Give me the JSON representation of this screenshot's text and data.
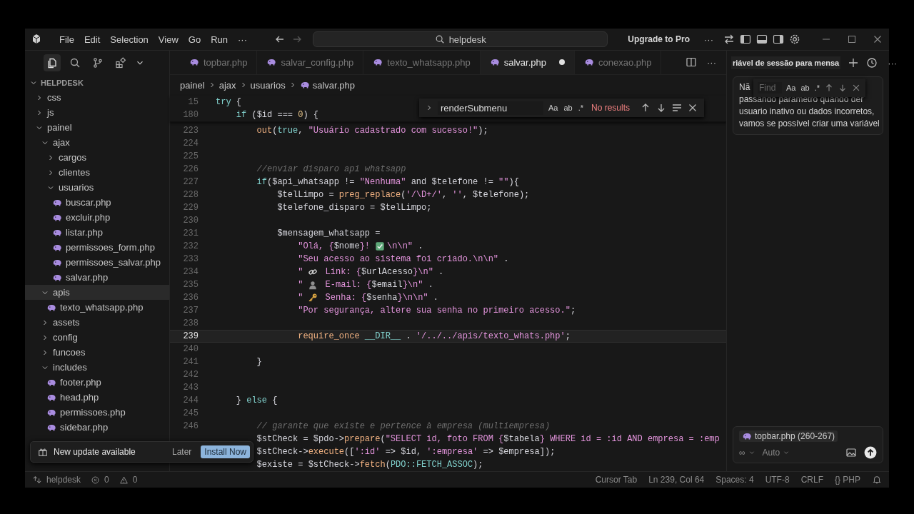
{
  "menu_bar": {
    "items": [
      "File",
      "Edit",
      "Selection",
      "View",
      "Go",
      "Run"
    ],
    "overflow": "···"
  },
  "command_center": {
    "value": "helpdesk"
  },
  "upgrade_button": "Upgrade to Pro",
  "title_overflow": "···",
  "activity_bar": [
    {
      "kind": "explorer",
      "selected": true
    },
    {
      "kind": "search",
      "selected": false
    },
    {
      "kind": "source_control",
      "selected": false
    },
    {
      "kind": "extensions",
      "selected": false
    }
  ],
  "explorer": {
    "title": "HELPDESK",
    "tree": [
      {
        "label": "css",
        "kind": "folder",
        "expanded": false,
        "selected": false
      },
      {
        "label": "js",
        "kind": "folder",
        "expanded": false,
        "selected": false
      },
      {
        "label": "painel",
        "kind": "folder",
        "expanded": true,
        "selected": false,
        "children": [
          {
            "label": "ajax",
            "kind": "folder",
            "expanded": true,
            "selected": false,
            "children": [
              {
                "label": "cargos",
                "kind": "folder",
                "expanded": false,
                "selected": false
              },
              {
                "label": "clientes",
                "kind": "folder",
                "expanded": false,
                "selected": false
              },
              {
                "label": "usuarios",
                "kind": "folder",
                "expanded": true,
                "selected": false,
                "children": [
                  {
                    "label": "buscar.php",
                    "kind": "file",
                    "selected": false
                  },
                  {
                    "label": "excluir.php",
                    "kind": "file",
                    "selected": false
                  },
                  {
                    "label": "listar.php",
                    "kind": "file",
                    "selected": false
                  },
                  {
                    "label": "permissoes_form.php",
                    "kind": "file",
                    "selected": false
                  },
                  {
                    "label": "permissoes_salvar.php",
                    "kind": "file",
                    "selected": false
                  },
                  {
                    "label": "salvar.php",
                    "kind": "file",
                    "selected": false
                  }
                ]
              }
            ]
          },
          {
            "label": "apis",
            "kind": "folder",
            "expanded": true,
            "selected": true,
            "children": [
              {
                "label": "texto_whatsapp.php",
                "kind": "file",
                "selected": false
              }
            ]
          },
          {
            "label": "assets",
            "kind": "folder",
            "expanded": false,
            "selected": false
          },
          {
            "label": "config",
            "kind": "folder",
            "expanded": false,
            "selected": false
          },
          {
            "label": "funcoes",
            "kind": "folder",
            "expanded": false,
            "selected": false
          },
          {
            "label": "includes",
            "kind": "folder",
            "expanded": true,
            "selected": false,
            "children": [
              {
                "label": "footer.php",
                "kind": "file",
                "selected": false
              },
              {
                "label": "head.php",
                "kind": "file",
                "selected": false
              },
              {
                "label": "permissoes.php",
                "kind": "file",
                "selected": false
              },
              {
                "label": "sidebar.php",
                "kind": "file",
                "selected": false
              }
            ]
          }
        ]
      }
    ]
  },
  "tabs": [
    {
      "label": "topbar.php",
      "selected": false,
      "modified": false
    },
    {
      "label": "salvar_config.php",
      "selected": false,
      "modified": false
    },
    {
      "label": "texto_whatsapp.php",
      "selected": false,
      "modified": false
    },
    {
      "label": "salvar.php",
      "selected": true,
      "modified": true
    },
    {
      "label": "conexao.php",
      "selected": false,
      "modified": false
    }
  ],
  "tab_overflow": "···",
  "breadcrumb": [
    "painel",
    "ajax",
    "usuarios",
    "salvar.php"
  ],
  "find_widget": {
    "value": "renderSubmenu",
    "options": [
      "Aa",
      "ab",
      ".*"
    ],
    "result": "No results"
  },
  "code": {
    "sticky": [
      {
        "num": "15",
        "current": false,
        "tokens": [
          {
            "text": "try",
            "kind": "kw"
          },
          {
            "text": " {",
            "kind": "p"
          }
        ]
      },
      {
        "num": "180",
        "current": false,
        "tokens": [
          {
            "text": "    if",
            "kind": "kw"
          },
          {
            "text": " (",
            "kind": "p"
          },
          {
            "text": "$id",
            "kind": "v"
          },
          {
            "text": " === ",
            "kind": "p"
          },
          {
            "text": "0",
            "kind": "n"
          },
          {
            "text": ") {",
            "kind": "p"
          }
        ]
      }
    ],
    "lines": [
      {
        "num": "223",
        "current": false,
        "tokens": [
          {
            "text": "        out",
            "kind": "fn"
          },
          {
            "text": "(",
            "kind": "p"
          },
          {
            "text": "true",
            "kind": "c"
          },
          {
            "text": ", ",
            "kind": "p"
          },
          {
            "text": "\"Usuário cadastrado com sucesso!\"",
            "kind": "s"
          },
          {
            "text": ");",
            "kind": "p"
          }
        ]
      },
      {
        "num": "224",
        "current": false
      },
      {
        "num": "225",
        "current": false
      },
      {
        "num": "226",
        "current": false,
        "tokens": [
          {
            "text": "        //enviar disparo api whatsapp",
            "kind": "cm"
          }
        ]
      },
      {
        "num": "227",
        "current": false,
        "tokens": [
          {
            "text": "        if",
            "kind": "kw"
          },
          {
            "text": "(",
            "kind": "p"
          },
          {
            "text": "$api_whatsapp",
            "kind": "v"
          },
          {
            "text": " != ",
            "kind": "p"
          },
          {
            "text": "\"Nenhuma\"",
            "kind": "s"
          },
          {
            "text": " and ",
            "kind": "p"
          },
          {
            "text": "$telefone",
            "kind": "v"
          },
          {
            "text": " != ",
            "kind": "p"
          },
          {
            "text": "\"\"",
            "kind": "s"
          },
          {
            "text": "){",
            "kind": "p"
          }
        ]
      },
      {
        "num": "228",
        "current": false,
        "tokens": [
          {
            "text": "            $telLimpo",
            "kind": "v"
          },
          {
            "text": " = ",
            "kind": "p"
          },
          {
            "text": "preg_replace",
            "kind": "fn"
          },
          {
            "text": "(",
            "kind": "p"
          },
          {
            "text": "'/\\D+/'",
            "kind": "s"
          },
          {
            "text": ", ",
            "kind": "p"
          },
          {
            "text": "''",
            "kind": "s"
          },
          {
            "text": ", ",
            "kind": "p"
          },
          {
            "text": "$telefone",
            "kind": "v"
          },
          {
            "text": ");",
            "kind": "p"
          }
        ]
      },
      {
        "num": "229",
        "current": false,
        "tokens": [
          {
            "text": "            $telefone_disparo",
            "kind": "v"
          },
          {
            "text": " = ",
            "kind": "p"
          },
          {
            "text": "$telLimpo",
            "kind": "v"
          },
          {
            "text": ";",
            "kind": "p"
          }
        ]
      },
      {
        "num": "230",
        "current": false
      },
      {
        "num": "231",
        "current": false,
        "tokens": [
          {
            "text": "            $mensagem_whatsapp",
            "kind": "v"
          },
          {
            "text": " =",
            "kind": "p"
          }
        ]
      },
      {
        "num": "232",
        "current": false,
        "tokens": [
          {
            "text": "                \"Olá, {",
            "kind": "s"
          },
          {
            "text": "$nome",
            "kind": "v"
          },
          {
            "text": "}!",
            "kind": "s"
          },
          {
            "kind": "emoji_check"
          },
          {
            "text": "\\n\\n\"",
            "kind": "s"
          },
          {
            "text": " .",
            "kind": "p"
          }
        ]
      },
      {
        "num": "233",
        "current": false,
        "tokens": [
          {
            "text": "                \"Seu acesso ao sistema foi criado.\\n\\n\"",
            "kind": "s"
          },
          {
            "text": " .",
            "kind": "p"
          }
        ]
      },
      {
        "num": "234",
        "current": false,
        "tokens": [
          {
            "text": "                \"",
            "kind": "s"
          },
          {
            "kind": "emoji_link"
          },
          {
            "text": " Link: {",
            "kind": "s"
          },
          {
            "text": "$urlAcesso",
            "kind": "v"
          },
          {
            "text": "}\\n\"",
            "kind": "s"
          },
          {
            "text": " .",
            "kind": "p"
          }
        ]
      },
      {
        "num": "235",
        "current": false,
        "tokens": [
          {
            "text": "                \"",
            "kind": "s"
          },
          {
            "kind": "emoji_person"
          },
          {
            "text": " E-mail: {",
            "kind": "s"
          },
          {
            "text": "$email",
            "kind": "v"
          },
          {
            "text": "}\\n\"",
            "kind": "s"
          },
          {
            "text": " .",
            "kind": "p"
          }
        ]
      },
      {
        "num": "236",
        "current": false,
        "tokens": [
          {
            "text": "                \"",
            "kind": "s"
          },
          {
            "kind": "emoji_key"
          },
          {
            "text": " Senha: {",
            "kind": "s"
          },
          {
            "text": "$senha",
            "kind": "v"
          },
          {
            "text": "}\\n\\n\"",
            "kind": "s"
          },
          {
            "text": " .",
            "kind": "p"
          }
        ]
      },
      {
        "num": "237",
        "current": false,
        "tokens": [
          {
            "text": "                \"Por segurança, altere sua senha no primeiro acesso.\"",
            "kind": "s"
          },
          {
            "text": ";",
            "kind": "p"
          }
        ]
      },
      {
        "num": "238",
        "current": false
      },
      {
        "num": "239",
        "current": true,
        "tokens": [
          {
            "text": "                require_once",
            "kind": "fn"
          },
          {
            "text": " __DIR__",
            "kind": "c"
          },
          {
            "text": " . ",
            "kind": "p"
          },
          {
            "text": "'/../../apis/texto_whats.php'",
            "kind": "s"
          },
          {
            "text": ";",
            "kind": "p"
          }
        ]
      },
      {
        "num": "240",
        "current": false
      },
      {
        "num": "241",
        "current": false,
        "tokens": [
          {
            "text": "        }",
            "kind": "p"
          }
        ]
      },
      {
        "num": "242",
        "current": false
      },
      {
        "num": "243",
        "current": false
      },
      {
        "num": "244",
        "current": false,
        "tokens": [
          {
            "text": "    } ",
            "kind": "p"
          },
          {
            "text": "else",
            "kind": "kw"
          },
          {
            "text": " {",
            "kind": "p"
          }
        ]
      },
      {
        "num": "245",
        "current": false
      },
      {
        "num": "246",
        "current": false,
        "tokens": [
          {
            "text": "        // garante que existe e pertence à empresa (multiempresa)",
            "kind": "cm"
          }
        ]
      },
      {
        "current": false,
        "tokens": [
          {
            "text": "        $stCheck",
            "kind": "v"
          },
          {
            "text": " = ",
            "kind": "p"
          },
          {
            "text": "$pdo",
            "kind": "v"
          },
          {
            "text": "->",
            "kind": "p"
          },
          {
            "text": "prepare",
            "kind": "fn"
          },
          {
            "text": "(",
            "kind": "p"
          },
          {
            "text": "\"SELECT id, foto FROM {",
            "kind": "s"
          },
          {
            "text": "$tabela",
            "kind": "v"
          },
          {
            "text": "} WHERE id = :id AND empresa = :emp",
            "kind": "s"
          }
        ]
      },
      {
        "current": false,
        "tokens": [
          {
            "text": "        $stCheck",
            "kind": "v"
          },
          {
            "text": "->",
            "kind": "p"
          },
          {
            "text": "execute",
            "kind": "fn"
          },
          {
            "text": "([",
            "kind": "p"
          },
          {
            "text": "':id'",
            "kind": "s"
          },
          {
            "text": " => ",
            "kind": "p"
          },
          {
            "text": "$id",
            "kind": "v"
          },
          {
            "text": ", ",
            "kind": "p"
          },
          {
            "text": "':empresa'",
            "kind": "s"
          },
          {
            "text": " => ",
            "kind": "p"
          },
          {
            "text": "$empresa",
            "kind": "v"
          },
          {
            "text": "]);",
            "kind": "p"
          }
        ]
      },
      {
        "current": false,
        "tokens": [
          {
            "text": "        $existe",
            "kind": "v"
          },
          {
            "text": " = ",
            "kind": "p"
          },
          {
            "text": "$stCheck",
            "kind": "v"
          },
          {
            "text": "->",
            "kind": "p"
          },
          {
            "text": "fetch",
            "kind": "fn"
          },
          {
            "text": "(",
            "kind": "p"
          },
          {
            "text": "PDO::FETCH_ASSOC",
            "kind": "c"
          },
          {
            "text": ");",
            "kind": "p"
          }
        ]
      }
    ]
  },
  "notification": {
    "message": "New update available",
    "buttons": [
      {
        "label": "Later",
        "primary": false
      },
      {
        "label": "Install Now",
        "primary": true
      }
    ]
  },
  "chat": {
    "title": "riável de sessão para mensa",
    "overflow": "···",
    "message": [
      "Nã",
      "passando parametro quando der",
      "usuario inativo ou dados incorretos,",
      "vamos se possível criar uma variável"
    ],
    "find": {
      "placeholder": "Find",
      "options": [
        "Aa",
        "ab",
        ".*"
      ]
    },
    "input": {
      "context_chip": "topbar.php (260-267)",
      "mode": "∞",
      "model": "Auto"
    }
  },
  "status_bar": {
    "workspace": "helpdesk",
    "errors": "0",
    "warnings": "0",
    "items": [
      "Cursor Tab",
      "Ln 239, Col 64",
      "Spaces: 4",
      "UTF-8",
      "CRLF",
      "{} PHP"
    ]
  }
}
